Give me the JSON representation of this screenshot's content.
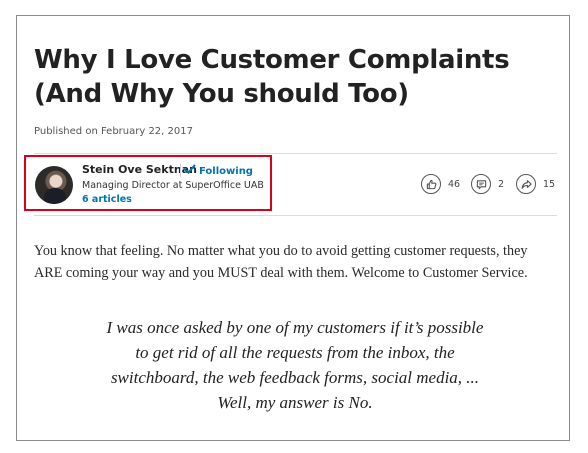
{
  "article": {
    "title": "Why I Love Customer Complaints (And Why You should Too)",
    "published": "Published on February 22, 2017"
  },
  "author": {
    "name": "Stein Ove Sektnan",
    "follow_label": "Following",
    "role": "Managing Director at SuperOffice UAB",
    "articles": "6 articles",
    "highlight_color": "#d9001b"
  },
  "social": {
    "likes": "46",
    "comments": "2",
    "shares": "15"
  },
  "content": {
    "paragraph": "You know that feeling. No matter what you do to avoid getting customer requests, they ARE coming your way and you MUST deal with them. Welcome to Customer Service.",
    "quote": "I was once asked by one of my customers if it’s possible to get rid of all the requests from the inbox, the switchboard, the web feedback forms, social media, ... Well, my answer is No."
  },
  "colors": {
    "link": "#0073b1",
    "border": "#8c8c8c"
  },
  "icons": {
    "like": "thumbs-up-icon",
    "comment": "comment-icon",
    "share": "share-arrow-icon",
    "follow": "checkmark-icon"
  }
}
